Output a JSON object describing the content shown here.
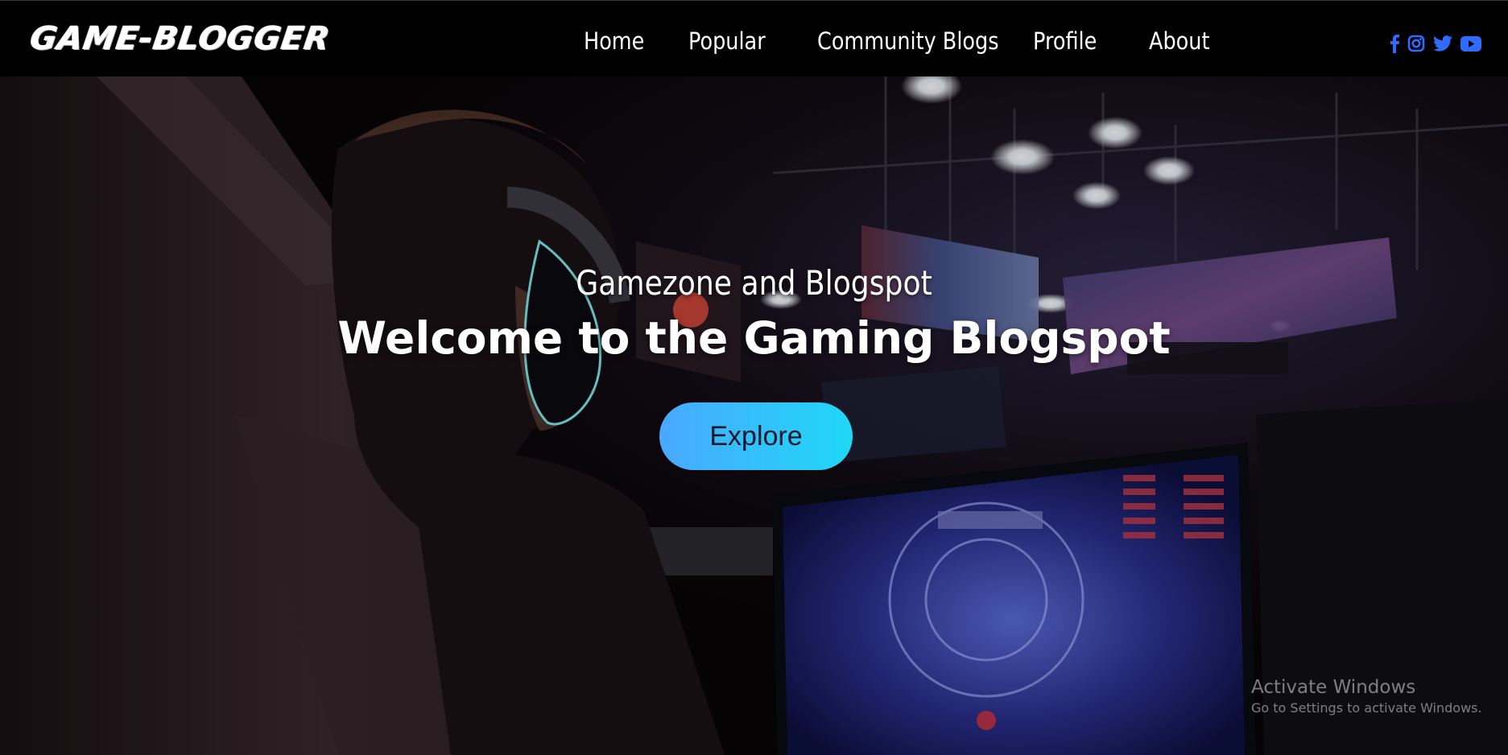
{
  "brand": {
    "logo_text": "GAME-BLOGGER"
  },
  "nav": {
    "home": "Home",
    "popular": "Popular",
    "community_blogs": "Community Blogs",
    "profile": "Profile",
    "about": "About"
  },
  "socials": [
    {
      "icon": "facebook-icon"
    },
    {
      "icon": "instagram-icon"
    },
    {
      "icon": "twitter-icon"
    },
    {
      "icon": "youtube-icon"
    }
  ],
  "hero": {
    "subtitle": "Gamezone and Blogspot",
    "title": "Welcome to the Gaming Blogspot",
    "cta_label": "Explore"
  },
  "watermark": {
    "title": "Activate Windows",
    "subtitle": "Go to Settings to activate Windows."
  },
  "colors": {
    "navbar_bg": "#000000",
    "social_icon": "#2f6bff",
    "cta_gradient_start": "#4aa8ff",
    "cta_gradient_end": "#1fd8f6",
    "text": "#ffffff"
  }
}
